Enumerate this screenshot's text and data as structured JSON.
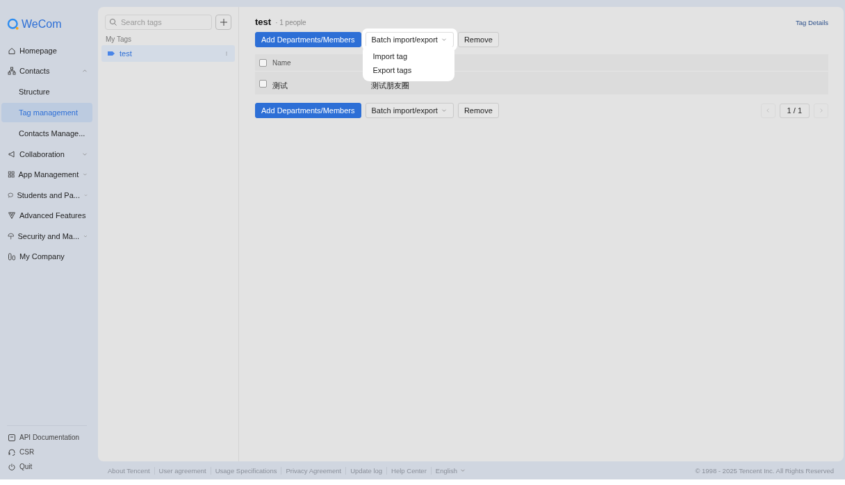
{
  "brand": {
    "name": "WeCom"
  },
  "sidebar": {
    "items": [
      {
        "label": "Homepage",
        "selected": false
      },
      {
        "label": "Contacts",
        "selected": false,
        "expanded": true,
        "children": [
          {
            "label": "Structure",
            "selected": false
          },
          {
            "label": "Tag management",
            "selected": true
          },
          {
            "label": "Contacts Manage...",
            "selected": false
          }
        ]
      },
      {
        "label": "Collaboration",
        "selected": false,
        "expanded": false
      },
      {
        "label": "App Management",
        "selected": false,
        "expanded": false
      },
      {
        "label": "Students and Pa...",
        "selected": false,
        "expanded": false
      },
      {
        "label": "Advanced Features",
        "selected": false
      },
      {
        "label": "Security and Ma...",
        "selected": false,
        "expanded": false
      },
      {
        "label": "My Company",
        "selected": false
      }
    ],
    "bottom_items": [
      {
        "label": "API Documentation"
      },
      {
        "label": "CSR"
      },
      {
        "label": "Quit"
      }
    ]
  },
  "tags_panel": {
    "search": {
      "placeholder": "Search tags"
    },
    "section": "My Tags",
    "tags": [
      {
        "label": "test",
        "selected": true
      }
    ]
  },
  "main": {
    "title": "test",
    "count": "· 1 people",
    "details_link": "Tag Details",
    "toolbar": {
      "add": "Add Departments/Members",
      "batch": "Batch import/export",
      "remove": "Remove",
      "menu": {
        "open": true,
        "items": [
          "Import tag",
          "Export tags"
        ]
      }
    },
    "table": {
      "header_checked": false,
      "columns": [
        "Name"
      ],
      "rows": [
        {
          "checked": false,
          "cells": [
            "测试",
            "测试朋友圈"
          ]
        }
      ]
    },
    "bottom_toolbar": {
      "add": "Add Departments/Members",
      "batch": "Batch import/export",
      "remove": "Remove"
    },
    "pagination": {
      "page": "1 / 1",
      "prev_disabled": true,
      "next_disabled": true
    }
  },
  "footer": {
    "links": [
      "About Tencent",
      "User agreement",
      "Usage Specifications",
      "Privacy Agreement",
      "Update log",
      "Help Center"
    ],
    "language": "English",
    "copyright": "© 1998 - 2025 Tencent Inc. All Rights Reserved"
  }
}
